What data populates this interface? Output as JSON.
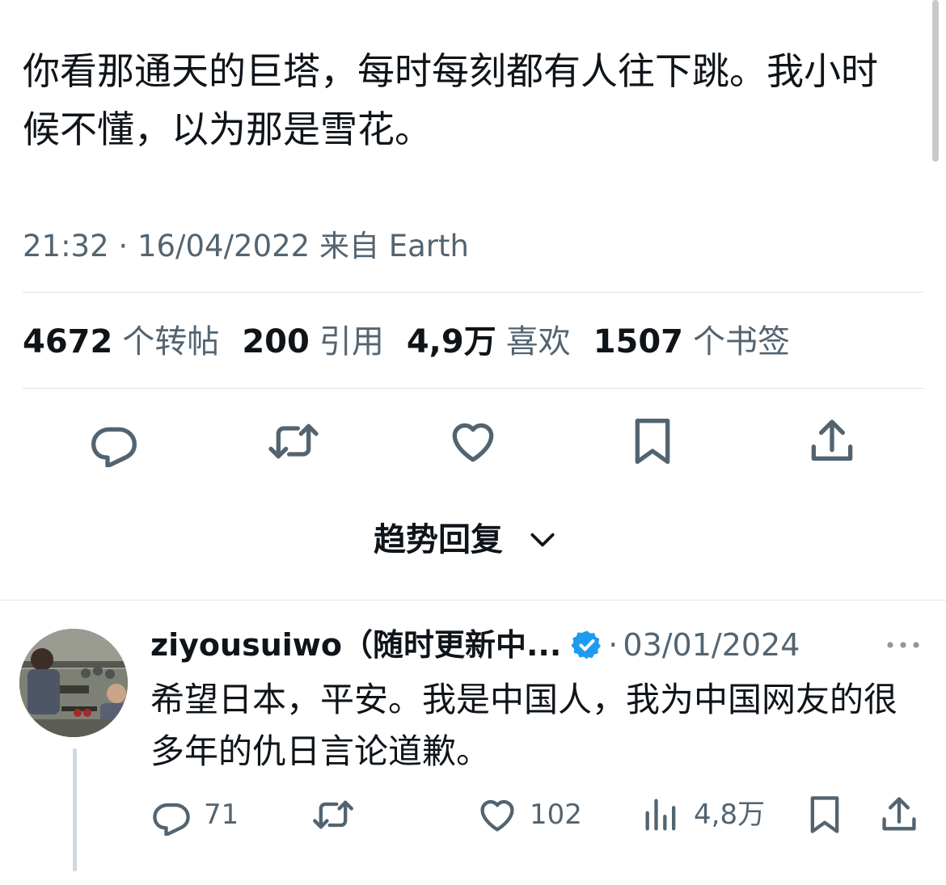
{
  "tweet": {
    "text": "你看那通天的巨塔，每时每刻都有人往下跳。我小时候不懂，以为那是雪花。",
    "time": "21:32",
    "date": "16/04/2022",
    "source_prefix": "来自",
    "source": "Earth"
  },
  "stats": [
    {
      "value": "4672",
      "label": "个转帖"
    },
    {
      "value": "200",
      "label": "引用"
    },
    {
      "value": "4,9万",
      "label": "喜欢"
    },
    {
      "value": "1507",
      "label": "个书签"
    }
  ],
  "actions": {
    "icons": [
      "reply-icon",
      "retweet-icon",
      "like-icon",
      "bookmark-icon",
      "share-icon"
    ]
  },
  "trending_replies": {
    "label": "趋势回复",
    "icon": "chevron-down-icon"
  },
  "reply": {
    "display_name": "ziyousuiwo（随时更新中...",
    "verified": true,
    "separator": "·",
    "date": "03/01/2024",
    "text": "希望日本，平安。我是中国人，我为中国网友的很多年的仇日言论道歉。",
    "reply_count": "71",
    "like_count": "102",
    "view_count": "4,8万"
  },
  "colors": {
    "text_primary": "#0f1419",
    "text_secondary": "#536471",
    "divider": "#e1e5e8",
    "verified_blue": "#1d9bf0",
    "thread_line": "#cfd9de"
  }
}
